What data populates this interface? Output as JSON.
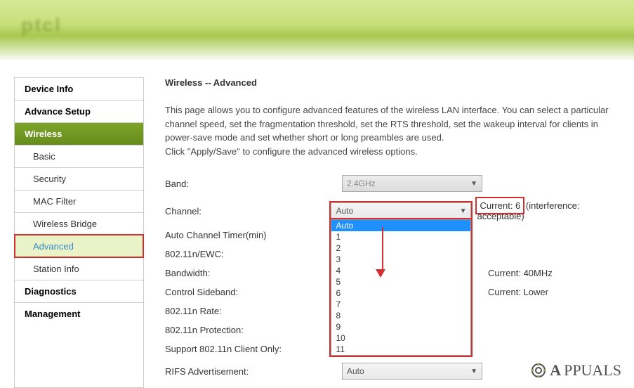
{
  "sidebar": {
    "items": [
      {
        "label": "Device Info",
        "type": "header"
      },
      {
        "label": "Advance Setup",
        "type": "header"
      },
      {
        "label": "Wireless",
        "type": "active"
      },
      {
        "label": "Basic",
        "type": "sub"
      },
      {
        "label": "Security",
        "type": "sub"
      },
      {
        "label": "MAC Filter",
        "type": "sub"
      },
      {
        "label": "Wireless Bridge",
        "type": "sub"
      },
      {
        "label": "Advanced",
        "type": "sub-highlight"
      },
      {
        "label": "Station Info",
        "type": "sub"
      },
      {
        "label": "Diagnostics",
        "type": "header"
      },
      {
        "label": "Management",
        "type": "header"
      }
    ]
  },
  "main": {
    "title_prefix": "Wireless",
    "title_sep": " -- ",
    "title_suffix": "Advanced",
    "description_line1": "This page allows you to configure advanced features of the wireless LAN interface. You can select a particular channel speed, set the fragmentation threshold, set the RTS threshold, set the wakeup interval for clients in power-save mode and set whether short or long preambles are used.",
    "description_line2": "Click \"Apply/Save\" to configure the advanced wireless options.",
    "fields": {
      "band": {
        "label": "Band:",
        "value": "2.4GHz"
      },
      "channel": {
        "label": "Channel:",
        "value": "Auto",
        "status_label": "Current: 6",
        "status_extra": "(interference: acceptable)"
      },
      "auto_timer": {
        "label": "Auto Channel Timer(min)"
      },
      "ewc": {
        "label": "802.11n/EWC:"
      },
      "bandwidth": {
        "label": "Bandwidth:",
        "status": "Current: 40MHz"
      },
      "sideband": {
        "label": "Control Sideband:",
        "status": "Current: Lower"
      },
      "rate": {
        "label": "802.11n Rate:"
      },
      "protection": {
        "label": "802.11n Protection:"
      },
      "client_only": {
        "label": "Support 802.11n Client Only:"
      },
      "rifs": {
        "label": "RIFS Advertisement:",
        "value": "Auto"
      }
    },
    "channel_options": [
      "Auto",
      "1",
      "2",
      "3",
      "4",
      "5",
      "6",
      "7",
      "8",
      "9",
      "10",
      "11"
    ]
  },
  "watermark": {
    "text": "APPUALS"
  }
}
